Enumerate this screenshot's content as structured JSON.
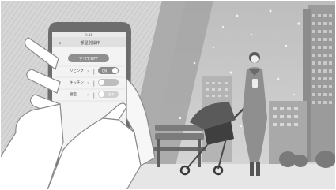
{
  "phone": {
    "status_time": "9:41",
    "nav_title": "部屋別操作",
    "all_off_button": "すべてOFF",
    "rooms": [
      {
        "label": "リビング",
        "toggle": "ON",
        "toggle_on": true
      },
      {
        "label": "キッチン",
        "toggle": "",
        "toggle_on": false
      },
      {
        "label": "寝室",
        "toggle": "OFF",
        "toggle_on": false
      }
    ]
  },
  "scene": {
    "description_tags": [
      "hand-holding-phone",
      "finger-tapping",
      "woman-with-phone",
      "baby-stroller",
      "park-bench",
      "city-buildings",
      "snow"
    ]
  },
  "colors": {
    "background": "#d2d2d2",
    "diagonal_band": "#a9a9a9",
    "sky_panel": "#c7c7c7",
    "phone_body": "#6b6b6b",
    "screen_bg": "#f3f3f3",
    "accent_gray": "#8a8a8a"
  }
}
